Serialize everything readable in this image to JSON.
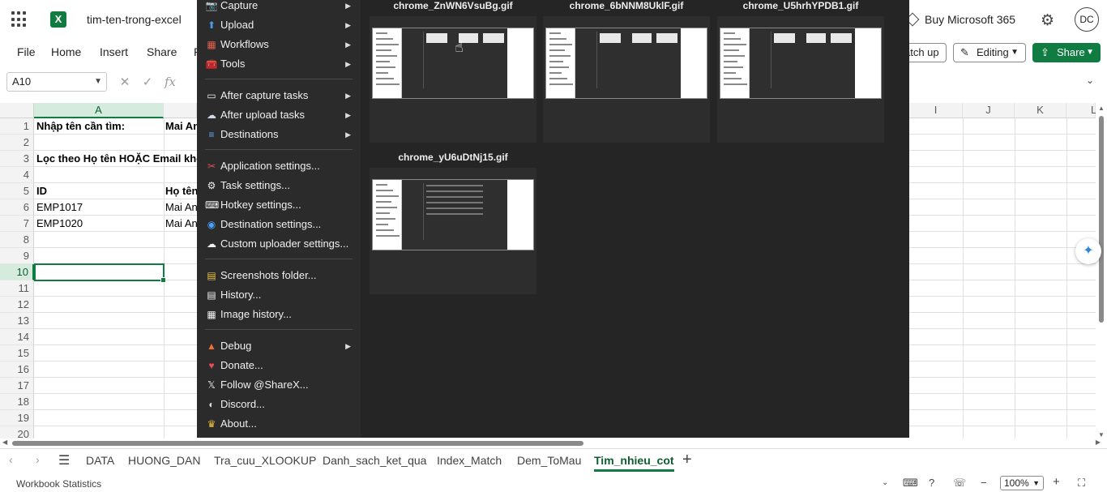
{
  "app": {
    "doc_title": "tim-ten-trong-excel",
    "buy_ms": "Buy Microsoft 365",
    "avatar_initials": "DC",
    "brand_color": "#107c41"
  },
  "ribbon": {
    "tabs": [
      "File",
      "Home",
      "Insert",
      "Share",
      "P"
    ],
    "catch_up": "atch up",
    "editing": "Editing",
    "share": "Share"
  },
  "formula_bar": {
    "name_box": "A10",
    "fx": "fx"
  },
  "grid": {
    "col_headers": [
      "A",
      "I",
      "J",
      "K",
      "L"
    ],
    "row_headers": [
      "1",
      "2",
      "3",
      "4",
      "5",
      "6",
      "7",
      "8",
      "9",
      "10",
      "11",
      "12",
      "13",
      "14",
      "15",
      "16",
      "17",
      "18",
      "19",
      "20"
    ],
    "cells": {
      "a1": "Nhập tên cần tìm:",
      "b1": "Mai An",
      "a3": "Lọc theo Họ tên HOẶC Email khớp",
      "a5": "ID",
      "b5": "Họ tên",
      "a6": "EMP1017",
      "b6": "Mai An",
      "a7": "EMP1020",
      "b7": "Mai An"
    }
  },
  "sheet_tabs": {
    "tabs": [
      "DATA",
      "HUONG_DAN",
      "Tra_cuu_XLOOKUP",
      "Danh_sach_ket_qua",
      "Index_Match",
      "Dem_ToMau",
      "Tim_nhieu_cot"
    ],
    "active": "Tim_nhieu_cot"
  },
  "status_bar": {
    "workbook_stats": "Workbook Statistics",
    "zoom": "100%"
  },
  "sharex_menu": {
    "items": [
      {
        "label": "Capture",
        "icon": "camera-icon",
        "submenu": true
      },
      {
        "label": "Upload",
        "icon": "upload-arrow-icon",
        "submenu": true
      },
      {
        "label": "Workflows",
        "icon": "workflows-grid-icon",
        "submenu": true
      },
      {
        "label": "Tools",
        "icon": "toolbox-icon",
        "submenu": true
      },
      {
        "label": "After capture tasks",
        "icon": "monitor-icon",
        "submenu": true
      },
      {
        "label": "After upload tasks",
        "icon": "cloud-icon",
        "submenu": true
      },
      {
        "label": "Destinations",
        "icon": "globe-stack-icon",
        "submenu": true
      },
      {
        "label": "Application settings...",
        "icon": "tools-cross-icon",
        "submenu": false
      },
      {
        "label": "Task settings...",
        "icon": "gear-icon",
        "submenu": false
      },
      {
        "label": "Hotkey settings...",
        "icon": "keyboard-icon",
        "submenu": false
      },
      {
        "label": "Destination settings...",
        "icon": "globe-icon",
        "submenu": false
      },
      {
        "label": "Custom uploader settings...",
        "icon": "cloud-gear-icon",
        "submenu": false
      },
      {
        "label": "Screenshots folder...",
        "icon": "folder-icon",
        "submenu": false
      },
      {
        "label": "History...",
        "icon": "history-icon",
        "submenu": false
      },
      {
        "label": "Image history...",
        "icon": "image-history-icon",
        "submenu": false
      },
      {
        "label": "Debug",
        "icon": "cone-icon",
        "submenu": true
      },
      {
        "label": "Donate...",
        "icon": "heart-icon",
        "submenu": false
      },
      {
        "label": "Follow @ShareX...",
        "icon": "x-logo-icon",
        "submenu": false
      },
      {
        "label": "Discord...",
        "icon": "discord-icon",
        "submenu": false
      },
      {
        "label": "About...",
        "icon": "crown-icon",
        "submenu": false
      }
    ]
  },
  "sharex_gallery": {
    "files": [
      "chrome_ZnWN6VsuBg.gif",
      "chrome_6bNNM8UklF.gif",
      "chrome_U5hrhYPDB1.gif",
      "chrome_yU6uDtNj15.gif"
    ]
  }
}
